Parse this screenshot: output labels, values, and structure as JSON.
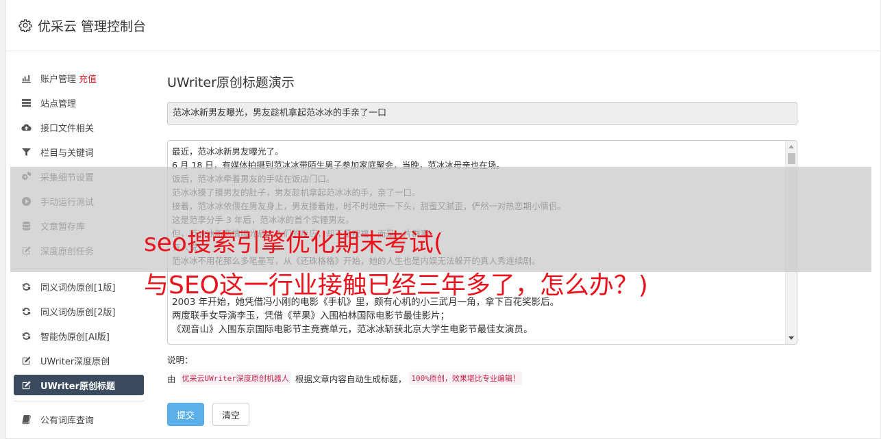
{
  "header": {
    "title": "优采云 管理控制台"
  },
  "sidebar": {
    "group1": [
      {
        "name": "nav-account",
        "icon": "bar-chart-icon",
        "label": "账户管理",
        "extra": "充值"
      },
      {
        "name": "nav-sites",
        "icon": "server-icon",
        "label": "站点管理"
      },
      {
        "name": "nav-api-files",
        "icon": "cloud-upload-icon",
        "label": "接口文件相关"
      },
      {
        "name": "nav-columns-keywords",
        "icon": "filter-icon",
        "label": "栏目与关键词"
      },
      {
        "name": "nav-collect-settings",
        "icon": "gears-icon",
        "label": "采集细节设置"
      },
      {
        "name": "nav-manual-run",
        "icon": "play-circle-icon",
        "label": "手动运行测试"
      },
      {
        "name": "nav-article-storage",
        "icon": "database-icon",
        "label": "文章暂存库"
      },
      {
        "name": "nav-deep-original-task",
        "icon": "edit-icon",
        "label": "深度原创任务"
      }
    ],
    "group2": [
      {
        "name": "nav-synonym-1",
        "icon": "refresh-icon",
        "label": "同义词伪原创[1版]"
      },
      {
        "name": "nav-synonym-2",
        "icon": "refresh-icon",
        "label": "同义词伪原创[2版]"
      },
      {
        "name": "nav-ai-pseudo",
        "icon": "refresh-icon",
        "label": "智能伪原创[AI版]"
      },
      {
        "name": "nav-uwriter-deep",
        "icon": "edit-icon",
        "label": "UWriter深度原创"
      },
      {
        "name": "nav-uwriter-title",
        "icon": "edit-icon",
        "label": "UWriter原创标题",
        "active": true
      }
    ],
    "group3": [
      {
        "name": "nav-public-thesaurus",
        "icon": "book-icon",
        "label": "公有词库查询"
      }
    ]
  },
  "main": {
    "title": "UWriter原创标题演示",
    "title_value": "范冰冰新男友曝光，男友趁机拿起范冰冰的手亲了一口",
    "content_lines": [
      "最近，范冰冰新男友曝光了。",
      "6 月 18 日，有媒体拍摄到范冰冰带陌生男子参加家庭聚会，当晚，范冰冰母亲也在场。",
      "饭后，范冰冰牵着男友的手站在饭店门口。",
      "范冰冰摸了摸男友的肚子，男友趁机拿起范冰冰的手，亲了一口。",
      "接着，范冰冰依偎在男友身上，男友搂着她，时不时地亲一下头，甜蜜又腻歪，俨然一对热恋期小情侣。",
      "这是范李分手 3 年后，范冰冰的首个实锤男友。",
      "但，范冰冰新恋情曝光后，人们的反应，却不是祝福，而是一片群嘲。",
      "有人说：",
      "范冰冰不用花那么多笔墨写，从《还珠格格》开始，她的人生也是内娱无法躲开的真人秀连续剧。",
      "",
      "",
      "2003 年开始，她凭借冯小刚的电影《手机》里，颇有心机的小三武月一角，拿下百花奖影后。",
      "两度联手女导演李玉，凭借《苹果》入围柏林国际电影节最佳影片；",
      "《观音山》入围东京国际电影节主竞赛单元，范冰冰斩获北京大学生电影节最佳女演员。"
    ],
    "notes_label": "说明：",
    "notes_prefix": "由",
    "notes_code1": "优采云UWriter深度原创机器人",
    "notes_middle": "根据文章内容自动生成标题，",
    "notes_code2": "100%原创，效果堪比专业编辑！",
    "submit_label": "提交",
    "clear_label": "清空"
  },
  "watermark": {
    "line1": "seo搜索引擎优化期末考试(",
    "line2": "与SEO这一行业接触已经三年多了，怎么办？)"
  },
  "colors": {
    "active_bg": "#3a4a5f",
    "primary": "#5bb0ec",
    "accent_red": "#d9232c",
    "watermark": "#e8131c"
  }
}
